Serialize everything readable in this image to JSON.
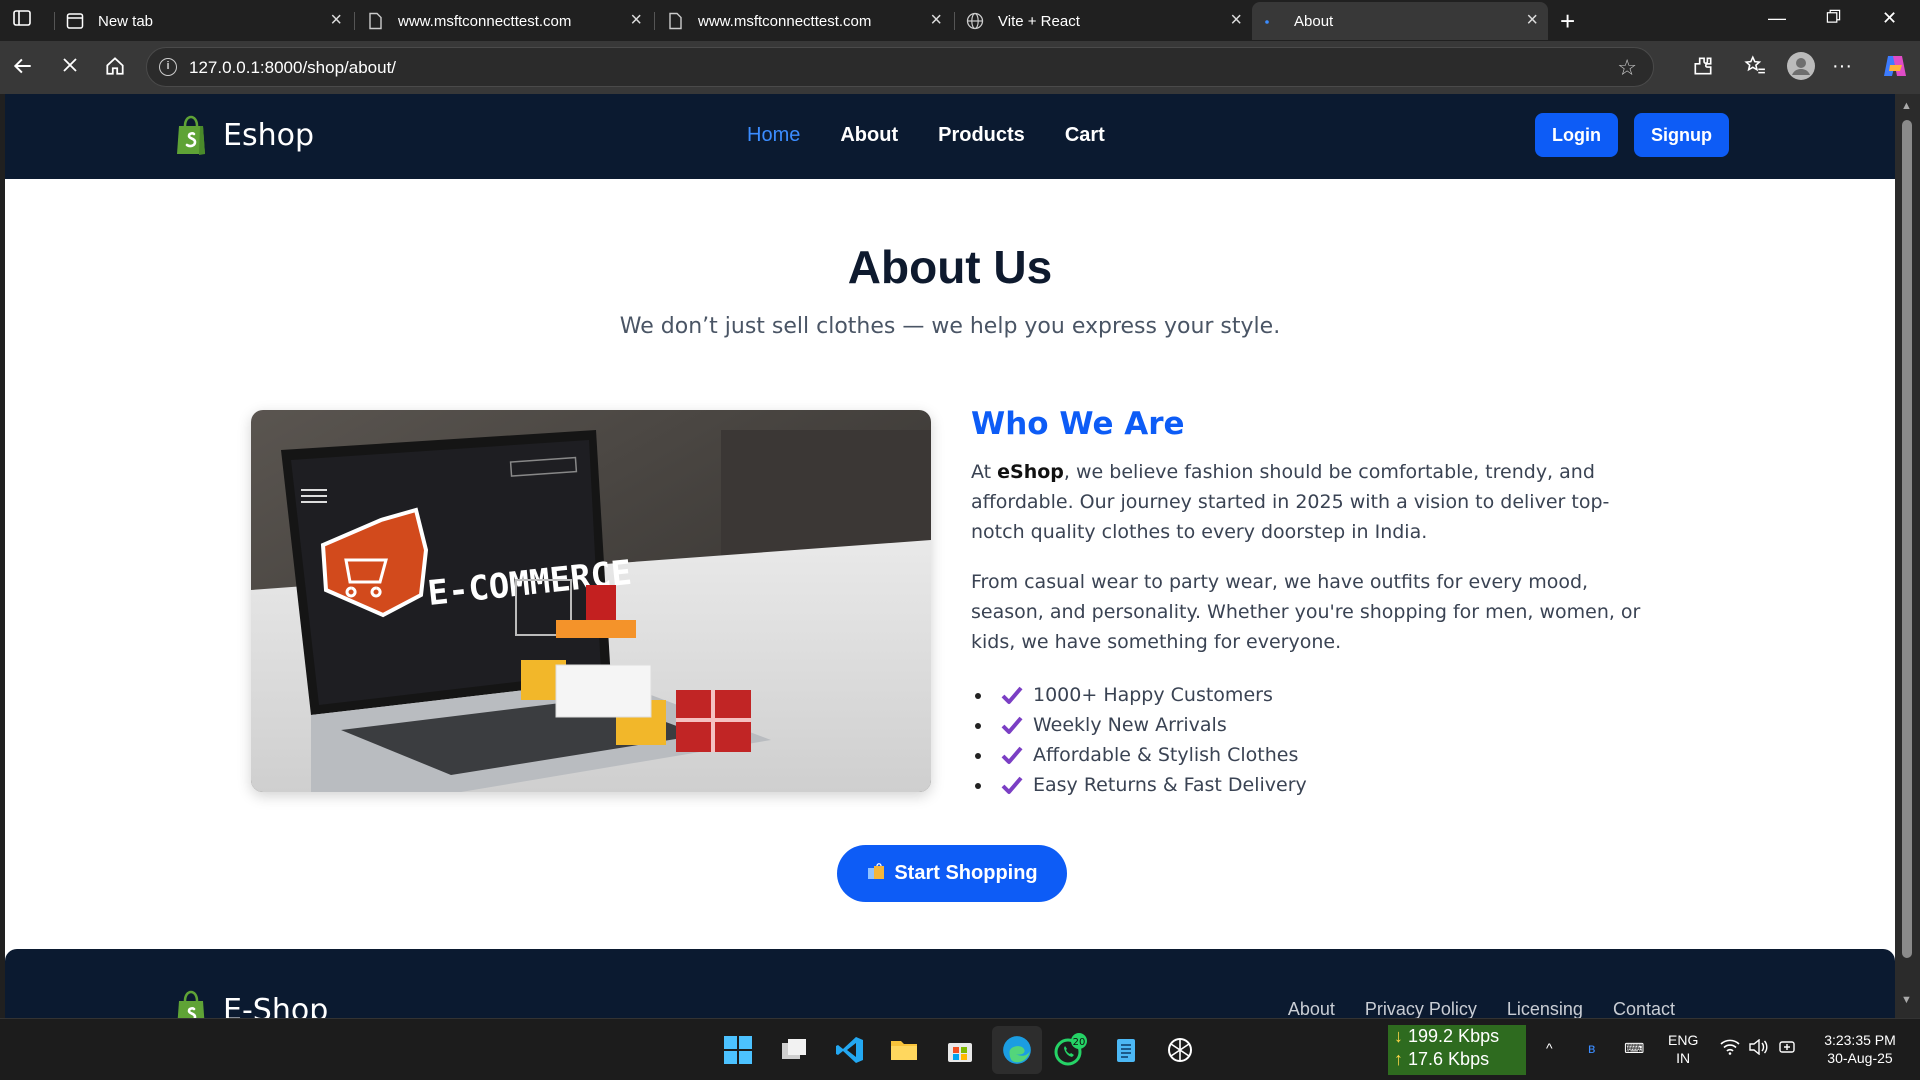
{
  "browser": {
    "tabs": [
      {
        "title": "New tab",
        "icon": "new-tab-icon"
      },
      {
        "title": "www.msftconnecttest.com",
        "icon": "page-icon"
      },
      {
        "title": "www.msftconnecttest.com",
        "icon": "page-icon"
      },
      {
        "title": "Vite + React",
        "icon": "globe-icon"
      },
      {
        "title": "About",
        "icon": "loading-icon",
        "active": true
      }
    ],
    "url": "127.0.0.1:8000/shop/about/"
  },
  "navbar": {
    "brand": "Eshop",
    "links": [
      "Home",
      "About",
      "Products",
      "Cart"
    ],
    "active_link": "Home",
    "login_label": "Login",
    "signup_label": "Signup"
  },
  "about": {
    "title": "About Us",
    "subtitle": "We don’t just sell clothes — we help you express your style."
  },
  "hero_image": {
    "alt": "E-COMMERCE"
  },
  "who": {
    "title": "Who We Are",
    "p1_prefix": "At ",
    "p1_brand": "eShop",
    "p1_rest": ", we believe fashion should be comfortable, trendy, and affordable. Our journey started in 2025 with a vision to deliver top-notch quality clothes to every doorstep in India.",
    "p2": "From casual wear to party wear, we have outfits for every mood, season, and personality. Whether you're shopping for men, women, or kids, we have something for everyone.",
    "features": [
      "1000+ Happy Customers",
      "Weekly New Arrivals",
      "Affordable & Stylish Clothes",
      "Easy Returns & Fast Delivery"
    ]
  },
  "cta": {
    "label": "Start Shopping"
  },
  "footer": {
    "brand": "E-Shop",
    "links": [
      "About",
      "Privacy Policy",
      "Licensing",
      "Contact"
    ]
  },
  "taskbar": {
    "net_down": "199.2 Kbps",
    "net_up": "17.6 Kbps",
    "whatsapp_badge": "20",
    "lang": "ENG",
    "region": "IN",
    "time": "3:23:35 PM",
    "date": "30-Aug-25"
  },
  "colors": {
    "accent": "#0d5cf6",
    "navbar_bg": "#0b1a30",
    "check": "#7b3fc4"
  }
}
